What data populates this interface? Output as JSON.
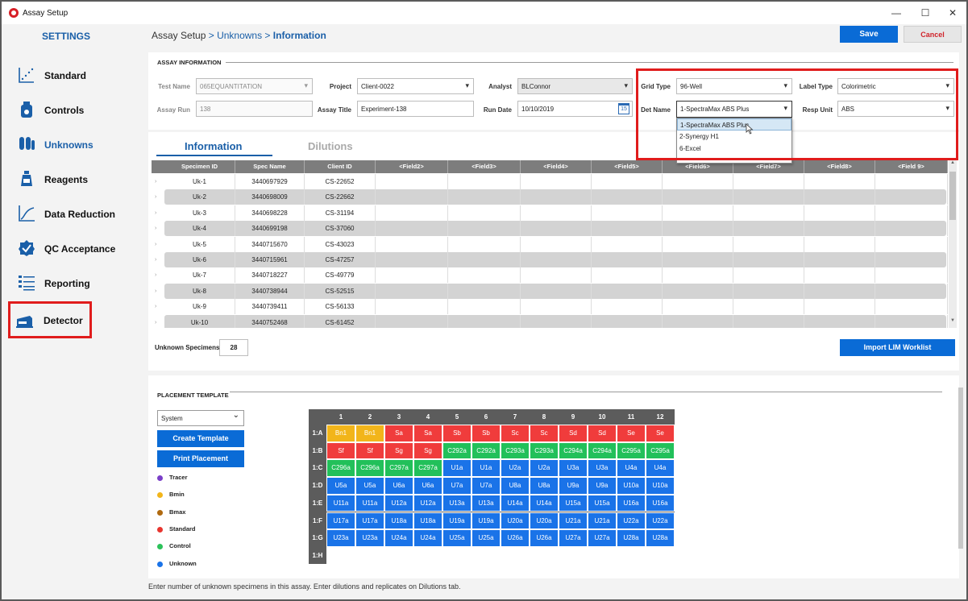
{
  "window": {
    "title": "Assay Setup",
    "controls": {
      "minimize": "—",
      "maximize": "☐",
      "close": "✕"
    }
  },
  "sidebar": {
    "title": "SETTINGS",
    "items": [
      {
        "label": "Standard",
        "icon": "standard-curve-icon"
      },
      {
        "label": "Controls",
        "icon": "controls-bottle-icon"
      },
      {
        "label": "Unknowns",
        "icon": "unknowns-tubes-icon",
        "active": true
      },
      {
        "label": "Reagents",
        "icon": "reagents-bottle-icon"
      },
      {
        "label": "Data Reduction",
        "icon": "data-reduction-curve-icon"
      },
      {
        "label": "QC Acceptance",
        "icon": "qc-check-badge-icon"
      },
      {
        "label": "Reporting",
        "icon": "reporting-list-icon"
      },
      {
        "label": "Detector",
        "icon": "detector-device-icon",
        "highlighted": true
      }
    ]
  },
  "header": {
    "crumb1": "Assay Setup",
    "sep": " > ",
    "crumb2": "Unknowns",
    "crumb3": "Information",
    "save_label": "Save",
    "cancel_label": "Cancel"
  },
  "assay_info": {
    "section_title": "ASSAY INFORMATION",
    "test_name_label": "Test Name",
    "test_name_value": "065EQUANTITATION",
    "assay_run_label": "Assay Run",
    "assay_run_value": "138",
    "project_label": "Project",
    "project_value": "Client-0022",
    "assay_title_label": "Assay Title",
    "assay_title_value": "Experiment-138",
    "analyst_label": "Analyst",
    "analyst_value": "BLConnor",
    "run_date_label": "Run Date",
    "run_date_value": "10/10/2019",
    "calendar_day": "15",
    "grid_type_label": "Grid Type",
    "grid_type_value": "96-Well",
    "det_name_label": "Det Name",
    "det_name_value": "1-SpectraMax ABS Plus",
    "det_name_options": [
      "1-SpectraMax ABS Plus",
      "2-Synergy H1",
      "6-Excel"
    ],
    "label_type_label": "Label Type",
    "label_type_value": "Colorimetric",
    "resp_unit_label": "Resp Unit",
    "resp_unit_value": "ABS"
  },
  "tabs": {
    "information": "Information",
    "dilutions": "Dilutions"
  },
  "table": {
    "headers": [
      "Specimen ID",
      "Spec Name",
      "Client ID",
      "<Field2>",
      "<Field3>",
      "<Field4>",
      "<Field5>",
      "<Field6>",
      "<Field7>",
      "<Field8>",
      "<Field 9>"
    ],
    "rows": [
      [
        "Uk-1",
        "3440697929",
        "CS-22652"
      ],
      [
        "Uk-2",
        "3440698009",
        "CS-22662"
      ],
      [
        "Uk-3",
        "3440698228",
        "CS-31194"
      ],
      [
        "Uk-4",
        "3440699198",
        "CS-37060"
      ],
      [
        "Uk-5",
        "3440715670",
        "CS-43023"
      ],
      [
        "Uk-6",
        "3440715961",
        "CS-47257"
      ],
      [
        "Uk-7",
        "3440718227",
        "CS-49779"
      ],
      [
        "Uk-8",
        "3440738944",
        "CS-52515"
      ],
      [
        "Uk-9",
        "3440739411",
        "CS-56133"
      ],
      [
        "Uk-10",
        "3440752468",
        "CS-61452"
      ]
    ]
  },
  "unknown_specimens": {
    "label": "Unknown Specimens",
    "value": "28"
  },
  "import_button": "Import LIM Worklist",
  "placement": {
    "section_title": "PLACEMENT TEMPLATE",
    "template_select": "System",
    "create_button": "Create Template",
    "print_button": "Print Placement",
    "legend": [
      {
        "label": "Tracer",
        "color": "#7a3fc8"
      },
      {
        "label": "Bmin",
        "color": "#f2b51a"
      },
      {
        "label": "Bmax",
        "color": "#b06a10"
      },
      {
        "label": "Standard",
        "color": "#e8352f"
      },
      {
        "label": "Control",
        "color": "#2cc25a"
      },
      {
        "label": "Unknown",
        "color": "#1a73e8"
      }
    ],
    "col_headers": [
      "1",
      "2",
      "3",
      "4",
      "5",
      "6",
      "7",
      "8",
      "9",
      "10",
      "11",
      "12"
    ],
    "row_headers": [
      "1:A",
      "1:B",
      "1:C",
      "1:D",
      "1:E",
      "1:F",
      "1:G",
      "1:H"
    ],
    "colors": {
      "bmin": "#f2b51a",
      "standard": "#f03c3c",
      "control": "#22c05a",
      "unknown": "#1a73e8",
      "empty": "#ffffff"
    },
    "wells": [
      [
        [
          "Bn1",
          "bmin"
        ],
        [
          "Bn1",
          "bmin"
        ],
        [
          "Sa",
          "standard"
        ],
        [
          "Sa",
          "standard"
        ],
        [
          "Sb",
          "standard"
        ],
        [
          "Sb",
          "standard"
        ],
        [
          "Sc",
          "standard"
        ],
        [
          "Sc",
          "standard"
        ],
        [
          "Sd",
          "standard"
        ],
        [
          "Sd",
          "standard"
        ],
        [
          "Se",
          "standard"
        ],
        [
          "Se",
          "standard"
        ]
      ],
      [
        [
          "Sf",
          "standard"
        ],
        [
          "Sf",
          "standard"
        ],
        [
          "Sg",
          "standard"
        ],
        [
          "Sg",
          "standard"
        ],
        [
          "C292a",
          "control"
        ],
        [
          "C292a",
          "control"
        ],
        [
          "C293a",
          "control"
        ],
        [
          "C293a",
          "control"
        ],
        [
          "C294a",
          "control"
        ],
        [
          "C294a",
          "control"
        ],
        [
          "C295a",
          "control"
        ],
        [
          "C295a",
          "control"
        ]
      ],
      [
        [
          "C296a",
          "control"
        ],
        [
          "C296a",
          "control"
        ],
        [
          "C297a",
          "control"
        ],
        [
          "C297a",
          "control"
        ],
        [
          "U1a",
          "unknown"
        ],
        [
          "U1a",
          "unknown"
        ],
        [
          "U2a",
          "unknown"
        ],
        [
          "U2a",
          "unknown"
        ],
        [
          "U3a",
          "unknown"
        ],
        [
          "U3a",
          "unknown"
        ],
        [
          "U4a",
          "unknown"
        ],
        [
          "U4a",
          "unknown"
        ]
      ],
      [
        [
          "U5a",
          "unknown"
        ],
        [
          "U5a",
          "unknown"
        ],
        [
          "U6a",
          "unknown"
        ],
        [
          "U6a",
          "unknown"
        ],
        [
          "U7a",
          "unknown"
        ],
        [
          "U7a",
          "unknown"
        ],
        [
          "U8a",
          "unknown"
        ],
        [
          "U8a",
          "unknown"
        ],
        [
          "U9a",
          "unknown"
        ],
        [
          "U9a",
          "unknown"
        ],
        [
          "U10a",
          "unknown"
        ],
        [
          "U10a",
          "unknown"
        ]
      ],
      [
        [
          "U11a",
          "unknown"
        ],
        [
          "U11a",
          "unknown"
        ],
        [
          "U12a",
          "unknown"
        ],
        [
          "U12a",
          "unknown"
        ],
        [
          "U13a",
          "unknown"
        ],
        [
          "U13a",
          "unknown"
        ],
        [
          "U14a",
          "unknown"
        ],
        [
          "U14a",
          "unknown"
        ],
        [
          "U15a",
          "unknown"
        ],
        [
          "U15a",
          "unknown"
        ],
        [
          "U16a",
          "unknown"
        ],
        [
          "U16a",
          "unknown"
        ]
      ],
      [
        [
          "U17a",
          "unknown"
        ],
        [
          "U17a",
          "unknown"
        ],
        [
          "U18a",
          "unknown"
        ],
        [
          "U18a",
          "unknown"
        ],
        [
          "U19a",
          "unknown"
        ],
        [
          "U19a",
          "unknown"
        ],
        [
          "U20a",
          "unknown"
        ],
        [
          "U20a",
          "unknown"
        ],
        [
          "U21a",
          "unknown"
        ],
        [
          "U21a",
          "unknown"
        ],
        [
          "U22a",
          "unknown"
        ],
        [
          "U22a",
          "unknown"
        ]
      ],
      [
        [
          "U23a",
          "unknown"
        ],
        [
          "U23a",
          "unknown"
        ],
        [
          "U24a",
          "unknown"
        ],
        [
          "U24a",
          "unknown"
        ],
        [
          "U25a",
          "unknown"
        ],
        [
          "U25a",
          "unknown"
        ],
        [
          "U26a",
          "unknown"
        ],
        [
          "U26a",
          "unknown"
        ],
        [
          "U27a",
          "unknown"
        ],
        [
          "U27a",
          "unknown"
        ],
        [
          "U28a",
          "unknown"
        ],
        [
          "U28a",
          "unknown"
        ]
      ],
      [
        [
          "",
          "empty"
        ],
        [
          "",
          "empty"
        ],
        [
          "",
          "empty"
        ],
        [
          "",
          "empty"
        ],
        [
          "",
          "empty"
        ],
        [
          "",
          "empty"
        ],
        [
          "",
          "empty"
        ],
        [
          "",
          "empty"
        ],
        [
          "",
          "empty"
        ],
        [
          "",
          "empty"
        ],
        [
          "",
          "empty"
        ],
        [
          "",
          "empty"
        ]
      ]
    ]
  },
  "footer_note": "Enter number of unknown specimens in this assay.  Enter dilutions and replicates on Dilutions tab."
}
